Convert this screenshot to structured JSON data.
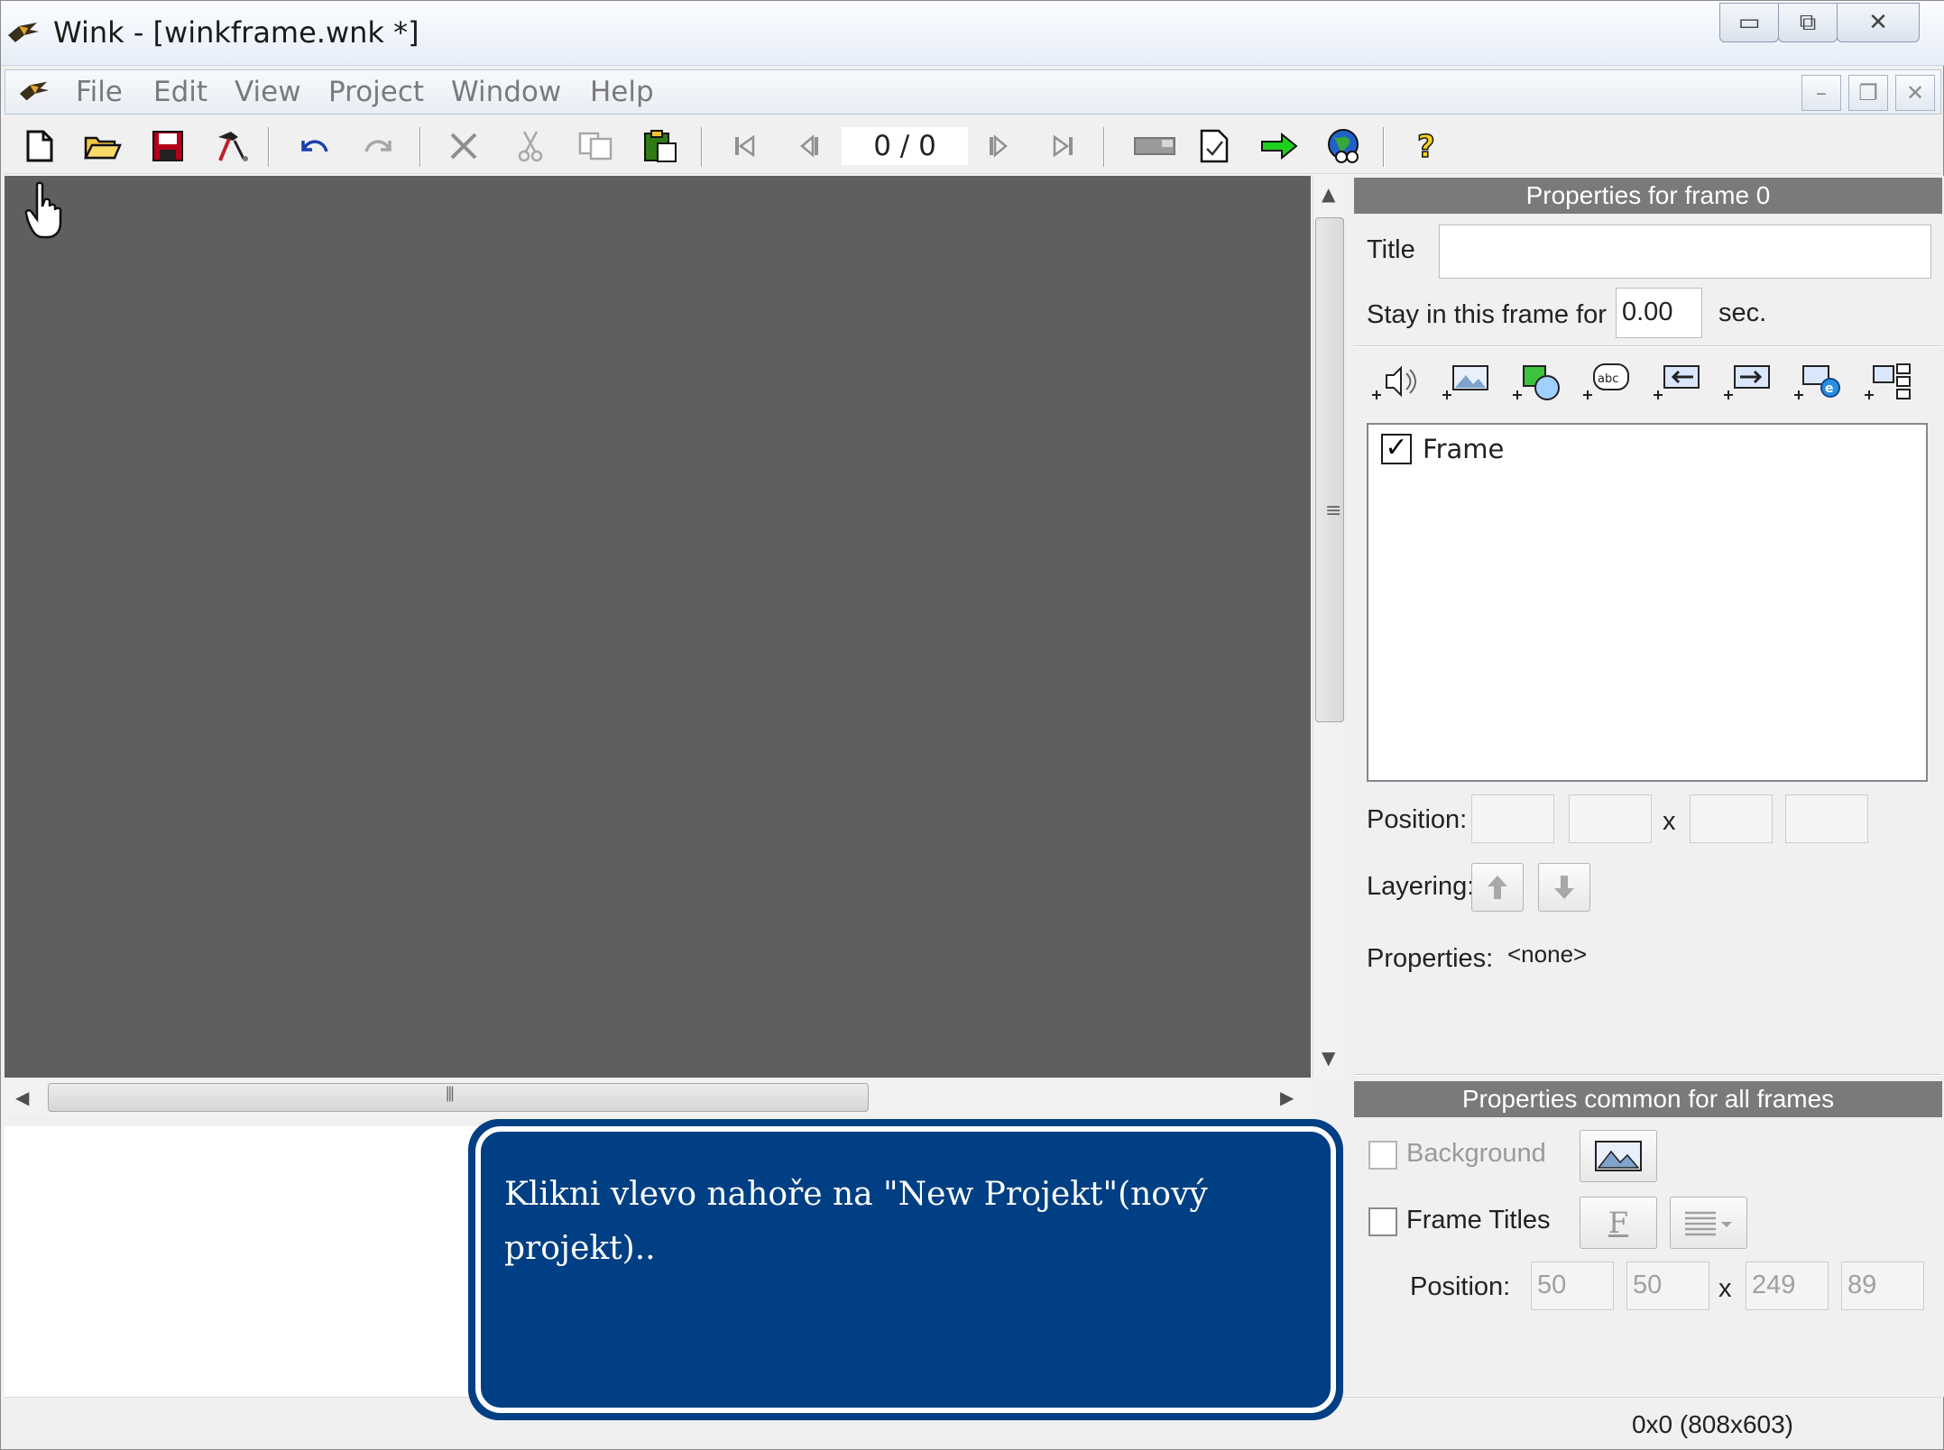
{
  "window": {
    "title": "Wink - [winkframe.wnk *]",
    "controls": {
      "minimize": "▭",
      "restore": "⧉",
      "close": "✕"
    }
  },
  "menu": {
    "items": [
      "File",
      "Edit",
      "View",
      "Project",
      "Window",
      "Help"
    ],
    "mdi": {
      "minimize": "–",
      "restore": "❐",
      "close": "✕"
    }
  },
  "toolbar": {
    "frame_counter": "0 / 0"
  },
  "frame_panel": {
    "header": "Properties for frame 0",
    "title_label": "Title",
    "title_value": "",
    "stay_label": "Stay in this frame for",
    "stay_value": "0.00",
    "stay_unit": "sec.",
    "list_items": [
      {
        "label": "Frame",
        "checked": true
      }
    ],
    "position_label": "Position:",
    "position_x_sep": "x",
    "layering_label": "Layering:",
    "properties_label": "Properties:",
    "properties_value": "<none>"
  },
  "common_panel": {
    "header": "Properties common for all frames",
    "background_label": "Background",
    "frame_titles_label": "Frame Titles",
    "font_button": "F",
    "position_label": "Position:",
    "position_x_sep": "x",
    "pos": [
      "50",
      "50",
      "249",
      "89"
    ]
  },
  "callout": {
    "text": "Klikni vlevo nahoře na \"New Projekt\"(nový projekt).."
  },
  "status": {
    "text": "0x0 (808x603)"
  },
  "colors": {
    "canvas": "#5f5f5f",
    "callout": "#003f83",
    "panel_header": "#7a7a7a"
  }
}
